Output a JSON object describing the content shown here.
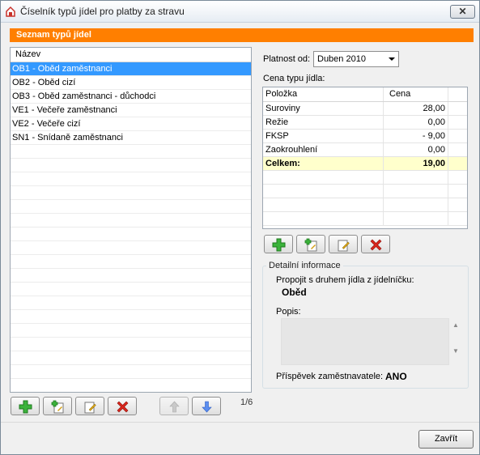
{
  "window": {
    "title": "Číselník typů jídel pro platby za stravu"
  },
  "section_header": "Seznam typů jídel",
  "list": {
    "column": "Název",
    "items": [
      "OB1 - Oběd zaměstnanci",
      "OB2 - Oběd cizí",
      "OB3 - Oběd zaměstnanci - důchodci",
      "VE1 - Večeře zaměstnanci",
      "VE2 - Večeře cizí",
      "SN1 - Snídaně zaměstnanci"
    ],
    "selected_index": 0,
    "counter": "1/6"
  },
  "validity": {
    "label": "Platnost od:",
    "value": "Duben 2010"
  },
  "price": {
    "label": "Cena typu jídla:",
    "columns": [
      "Položka",
      "Cena"
    ],
    "rows": [
      {
        "item": "Suroviny",
        "price": "28,00"
      },
      {
        "item": "Režie",
        "price": "0,00"
      },
      {
        "item": "FKSP",
        "price": "-  9,00"
      },
      {
        "item": "Zaokrouhlení",
        "price": "0,00"
      }
    ],
    "total": {
      "item": "Celkem:",
      "price": "19,00"
    }
  },
  "detail": {
    "title": "Detailní informace",
    "link_label": "Propojit s druhem jídla z jídelníčku:",
    "link_value": "Oběd",
    "description_label": "Popis:",
    "description_value": "",
    "contribution_label": "Příspěvek zaměstnavatele:",
    "contribution_value": "ANO"
  },
  "footer": {
    "close_label": "Zavřít"
  },
  "colors": {
    "header_orange": "#ff7f00",
    "selection": "#3399ff",
    "total_row": "#ffffcc"
  },
  "icons": [
    "app-icon",
    "close-icon",
    "add-icon",
    "add-copy-icon",
    "edit-icon",
    "delete-icon",
    "arrow-up-icon",
    "arrow-down-icon"
  ]
}
